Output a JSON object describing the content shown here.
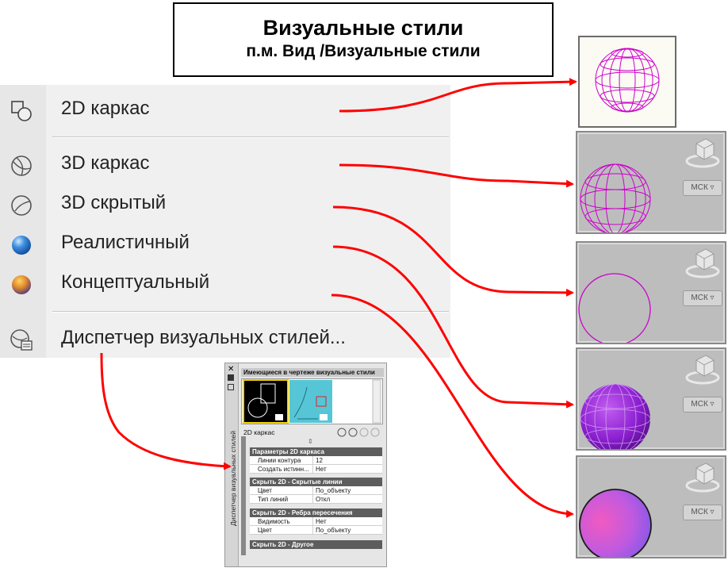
{
  "title": {
    "line1": "Визуальные стили",
    "line2": "п.м. Вид /Визуальные стили"
  },
  "menu": {
    "items": [
      {
        "label": "2D каркас",
        "icon": "wireframe-2d-icon"
      },
      {
        "label": "3D каркас",
        "icon": "wireframe-3d-icon"
      },
      {
        "label": "3D скрытый",
        "icon": "hidden-3d-icon"
      },
      {
        "label": "Реалистичный",
        "icon": "realistic-sphere-icon"
      },
      {
        "label": "Концептуальный",
        "icon": "conceptual-sphere-icon"
      },
      {
        "label": "Диспетчер визуальных стилей...",
        "icon": "visual-styles-manager-icon"
      }
    ]
  },
  "thumbnails": {
    "ucs_label": "МСК"
  },
  "palette": {
    "vertical_title": "Диспетчер визуальных стилей",
    "header": "Имеющиеся в чертеже визуальные стили",
    "current_style": "2D каркас",
    "sections": [
      {
        "title": "Параметры 2D каркаса",
        "rows": [
          {
            "k": "Линии контура",
            "v": "12"
          },
          {
            "k": "Создать истинн...",
            "v": "Нет"
          }
        ]
      },
      {
        "title": "Скрыть 2D - Скрытые линии",
        "rows": [
          {
            "k": "Цвет",
            "v": "По_объекту"
          },
          {
            "k": "Тип линий",
            "v": "Откл"
          }
        ]
      },
      {
        "title": "Скрыть 2D - Ребра пересечения",
        "rows": [
          {
            "k": "Видимость",
            "v": "Нет"
          },
          {
            "k": "Цвет",
            "v": "По_объекту"
          }
        ]
      },
      {
        "title": "Скрыть 2D - Другое",
        "rows": []
      }
    ]
  },
  "colors": {
    "arrow": "#ff0000",
    "wire": "#cc00cc",
    "realistic": "#8a1fd0",
    "conceptual": "#d04ad8"
  }
}
